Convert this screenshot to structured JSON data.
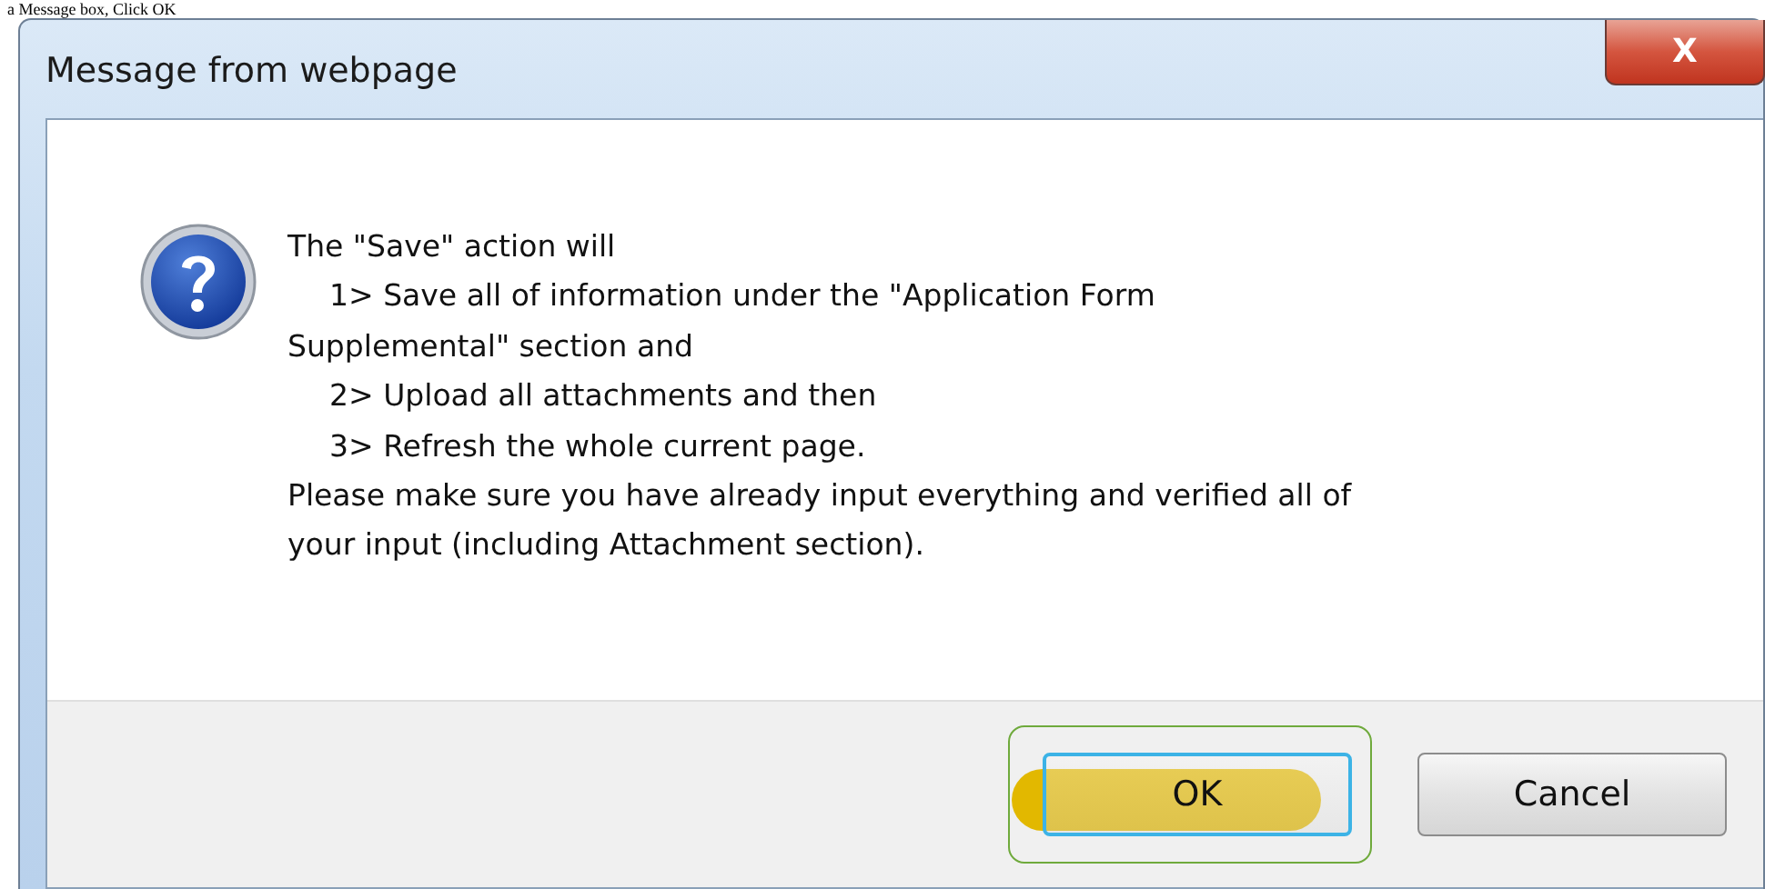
{
  "caption": "a Message box, Click OK",
  "window": {
    "title": "Message from webpage",
    "close_label": "X"
  },
  "message": {
    "lines": [
      {
        "kind": "text",
        "text": "The \"Save\" action will"
      },
      {
        "kind": "item",
        "text": "1> Save all of information under the \"Application Form"
      },
      {
        "kind": "text",
        "text": "Supplemental\" section and"
      },
      {
        "kind": "item",
        "text": "2> Upload all attachments and then"
      },
      {
        "kind": "item",
        "text": "3> Refresh the whole current page."
      },
      {
        "kind": "text",
        "text": "Please make sure you have already input everything and verified all of"
      },
      {
        "kind": "text",
        "text": "your input (including Attachment section)."
      }
    ]
  },
  "buttons": [
    {
      "label": "OK",
      "default": true,
      "highlighted": true
    },
    {
      "label": "Cancel",
      "default": false,
      "highlighted": false
    }
  ]
}
